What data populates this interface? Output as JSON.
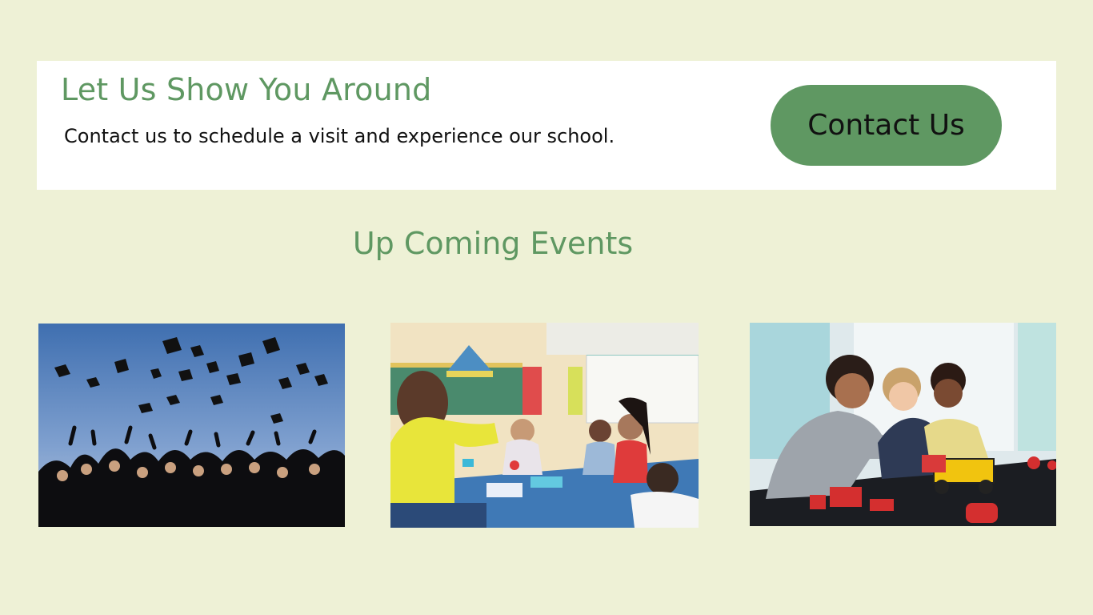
{
  "banner": {
    "title": "Let Us Show You Around",
    "subtitle": "Contact us to schedule a visit and experience our school.",
    "contact_button_label": "Contact Us"
  },
  "events": {
    "heading": "Up Coming Events",
    "cards": [
      {
        "image": "graduation-caps-photo"
      },
      {
        "image": "classroom-high-five-photo"
      },
      {
        "image": "robotics-students-photo"
      }
    ]
  },
  "colors": {
    "page_background": "#eef1d6",
    "accent_green": "#5f9862",
    "banner_background": "#ffffff",
    "text_dark": "#111111"
  }
}
